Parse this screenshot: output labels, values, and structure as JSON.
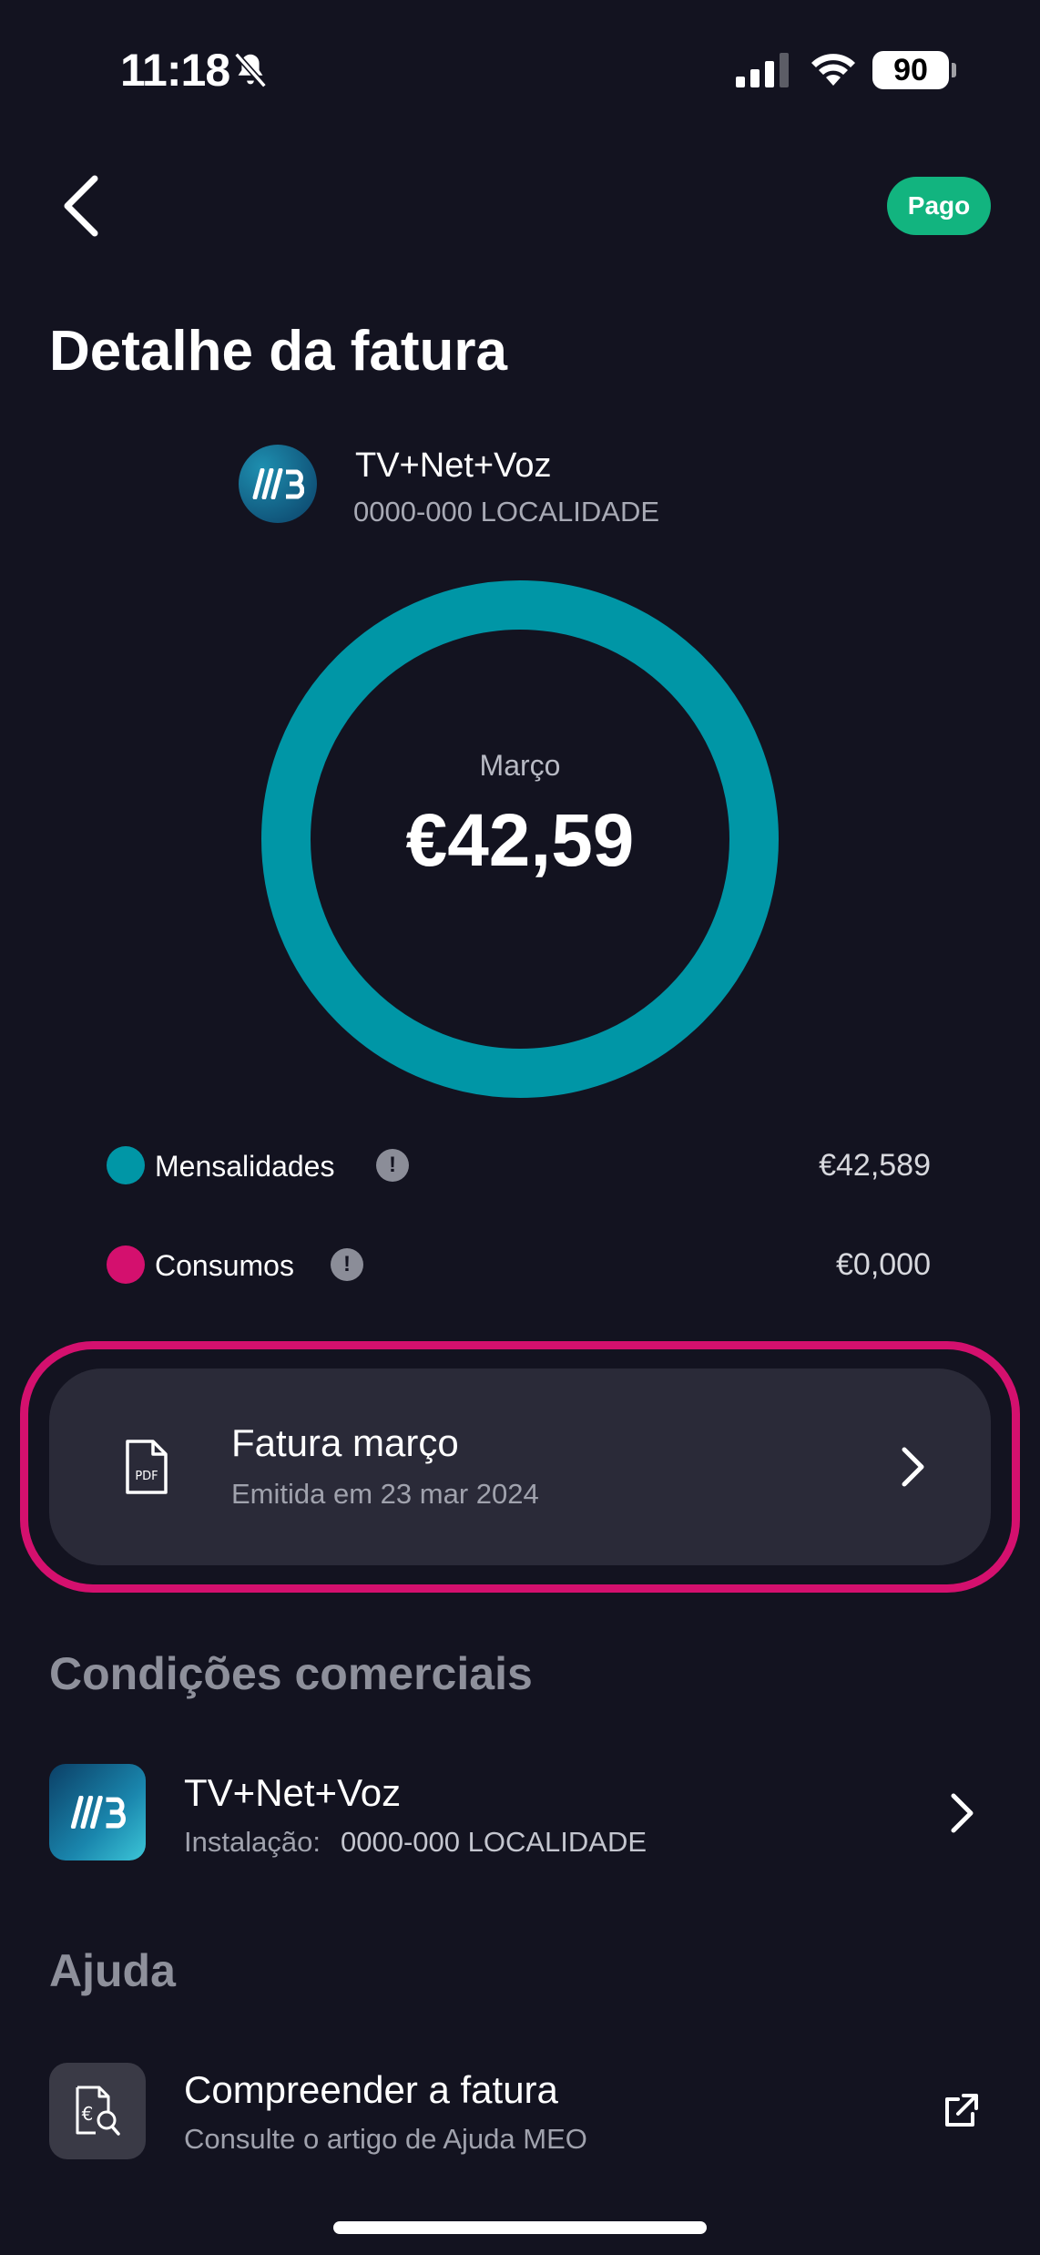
{
  "status_bar": {
    "time": "11:18",
    "battery": "90",
    "icons": [
      "bell-slash-icon",
      "signal-icon",
      "wifi-icon",
      "battery-icon"
    ]
  },
  "header": {
    "back_icon": "chevron-left-icon",
    "status_badge": "Pago",
    "title": "Detalhe da fatura"
  },
  "service": {
    "name": "TV+Net+Voz",
    "address": "0000-000 LOCALIDADE"
  },
  "summary": {
    "month": "Março",
    "total": "€42,59"
  },
  "breakdown": [
    {
      "label": "Mensalidades",
      "value": "€42,589",
      "color": "#0096a6"
    },
    {
      "label": "Consumos",
      "value": "€0,000",
      "color": "#d4106e"
    }
  ],
  "chart_data": {
    "type": "pie",
    "categories": [
      "Mensalidades",
      "Consumos"
    ],
    "values": [
      42.589,
      0.0
    ],
    "colors": [
      "#0096a6",
      "#d4106e"
    ]
  },
  "invoice": {
    "title": "Fatura março",
    "subtitle": "Emitida em 23 mar 2024",
    "icon": "pdf-file-icon"
  },
  "commercial": {
    "section_title": "Condições comerciais",
    "name": "TV+Net+Voz",
    "installation_label": "Instalação:",
    "installation_address": "0000-000 LOCALIDADE"
  },
  "help": {
    "section_title": "Ajuda",
    "title": "Compreender a fatura",
    "subtitle": "Consulte o artigo de Ajuda MEO",
    "icon": "euro-search-icon"
  },
  "colors": {
    "background": "#131320",
    "accent_teal": "#0096a6",
    "accent_magenta": "#d4106e",
    "paid_badge": "#12b47f",
    "card": "#2a2a38"
  }
}
